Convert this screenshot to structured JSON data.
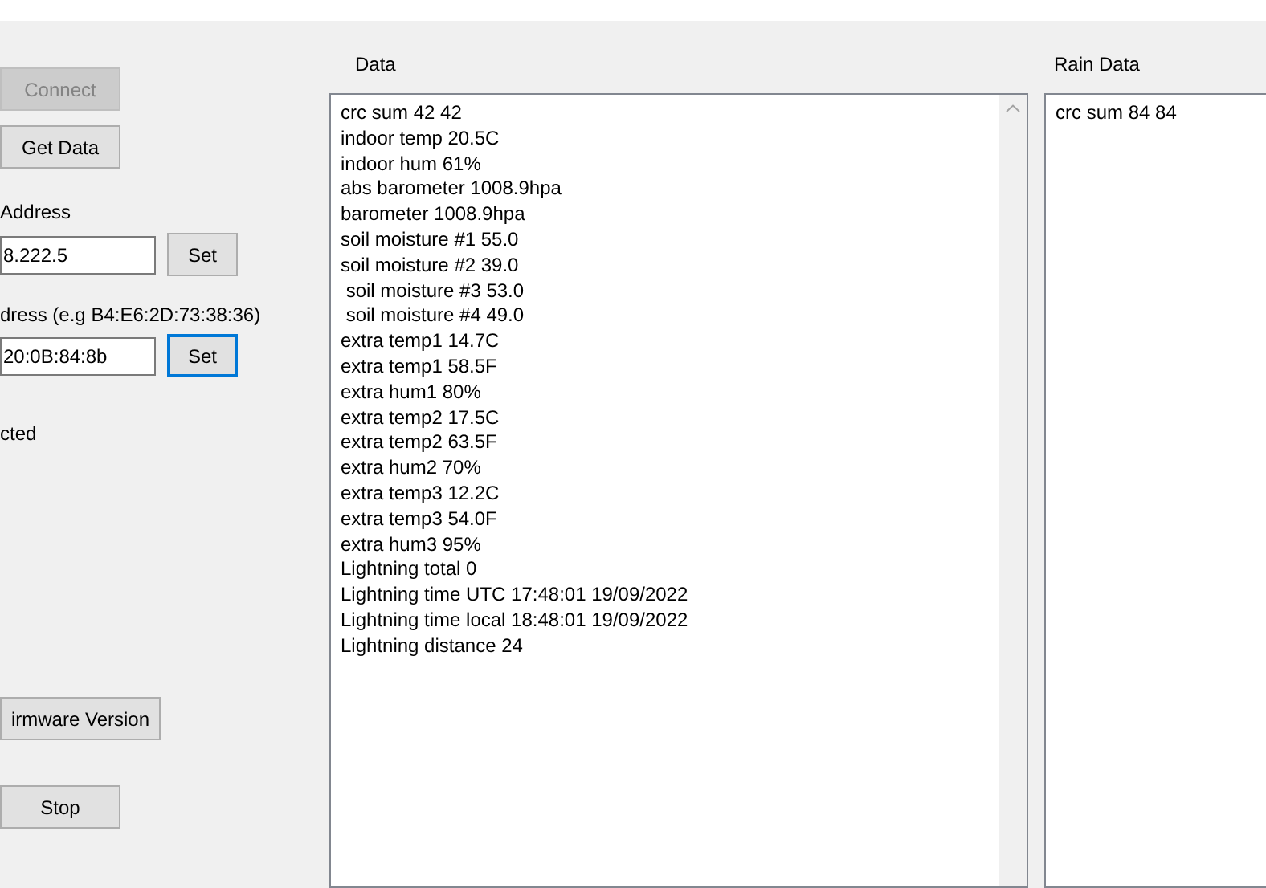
{
  "controls": {
    "connect_button": {
      "label": "Connect",
      "disabled": true
    },
    "get_data_button": {
      "label": "Get Data",
      "disabled": false
    },
    "ip_label": "Address",
    "ip_field": {
      "value": "8.222.5"
    },
    "ip_set_button": {
      "label": "Set",
      "focused": false
    },
    "mac_label": "dress (e.g B4:E6:2D:73:38:36)",
    "mac_field": {
      "value": "20:0B:84:8b"
    },
    "mac_set_button": {
      "label": "Set",
      "focused": true
    },
    "status": "cted",
    "firmware_button": {
      "label": "irmware Version"
    },
    "stop_button": {
      "label": "Stop"
    }
  },
  "data_panel": {
    "title": "Data",
    "lines": [
      "crc sum 42 42",
      "indoor temp 20.5C",
      "indoor hum 61%",
      "abs barometer 1008.9hpa",
      "barometer 1008.9hpa",
      "soil moisture #1 55.0",
      "soil moisture #2 39.0",
      " soil moisture #3 53.0",
      " soil moisture #4 49.0",
      "extra temp1 14.7C",
      "extra temp1 58.5F",
      "extra hum1 80%",
      "extra temp2 17.5C",
      "extra temp2 63.5F",
      "extra hum2 70%",
      "extra temp3 12.2C",
      "extra temp3 54.0F",
      "extra hum3 95%",
      "Lightning total 0",
      "Lightning time UTC 17:48:01 19/09/2022",
      "Lightning time local 18:48:01 19/09/2022",
      "Lightning distance 24"
    ]
  },
  "rain_panel": {
    "title": "Rain Data",
    "lines": [
      "crc sum 84 84"
    ]
  }
}
